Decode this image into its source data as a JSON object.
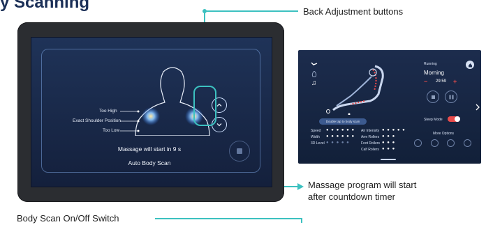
{
  "page": {
    "title": "y Scanning",
    "callouts": {
      "back_adjustment": "Back Adjustment buttons",
      "countdown_line1": "Massage program will start",
      "countdown_line2": "after countdown timer",
      "body_scan_switch": "Body Scan On/Off Switch"
    }
  },
  "scan_screen": {
    "labels": {
      "too_high": "Too High",
      "exact": "Exact Shoulder Position",
      "too_low": "Too Low"
    },
    "message": "Massage will start in 9 s",
    "auto_scan": "Auto Body Scan",
    "icons": [
      "chevron-up-icon",
      "chevron-down-icon",
      "stop-icon"
    ]
  },
  "running_screen": {
    "status": "Running",
    "program": "Morning",
    "timer": "29:59",
    "minus": "−",
    "plus": "+",
    "double_tap": "Double tap to body scan",
    "sleep_mode": "Sleep Mode",
    "more_options": "More Options",
    "settings": [
      {
        "label": "Speed",
        "dots": "● ● ● ● ● ●"
      },
      {
        "label": "Width",
        "dots": "● ● ● ● ● ●"
      },
      {
        "label": "3D Level",
        "dots": "● ● ● ● ●"
      }
    ],
    "intensity": [
      {
        "label": "Air Intensity",
        "dots": "● ● ● ● ●"
      },
      {
        "label": "Arm Rollers",
        "dots": "● ● ●"
      },
      {
        "label": "Foot Rollers",
        "dots": "● ● ●"
      },
      {
        "label": "Calf Rollers",
        "dots": "● ● ●"
      }
    ],
    "accent": "#e94b4b",
    "highlight": "#3cc1c0"
  }
}
